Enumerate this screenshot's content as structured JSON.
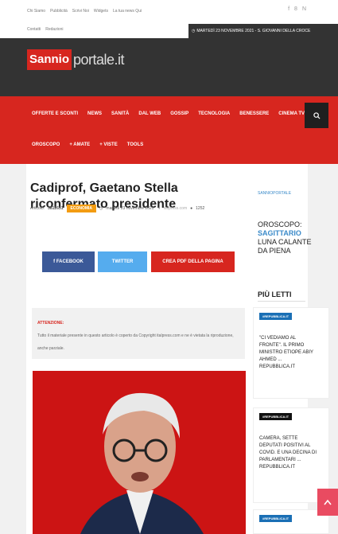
{
  "topbar": {
    "links": [
      "Chi Siamo",
      "Pubblicità",
      "Scrivi Noi",
      "Widgets",
      "La tua news Qui"
    ],
    "links2": [
      "Contatti",
      "Redazioni"
    ],
    "date": "MARTEDÌ 23 NOVEMBRE 2021 - S. GIOVANNI DELLA CROCE",
    "social": [
      "f",
      "8",
      "N"
    ]
  },
  "logo": {
    "red": "Sannio",
    "gray": "portale.it"
  },
  "nav": {
    "row1": [
      "OFFERTE E SCONTI",
      "NEWS",
      "SANITÀ",
      "DAL WEB",
      "GOSSIP",
      "TECNOLOGIA",
      "BENESSERE",
      "CINEMA TV"
    ],
    "row2": [
      "OROSCOPO",
      "+ AMATE",
      "+ VISTE",
      "TOOLS"
    ]
  },
  "article": {
    "title": "Cadiprof, Gaetano Stella riconfermato presidente",
    "id_label": "Articolo:",
    "id": "3812631",
    "category": "ECONOMIA",
    "date": "martedì 23 novembre 2021",
    "author": "italpress.com",
    "views": "1252"
  },
  "share": {
    "facebook": "f FACEBOOK",
    "twitter": "TWITTER",
    "pdf": "CREA PDF DELLA PAGINA"
  },
  "notice": {
    "heading": "ATTENZIONE:",
    "line1": "Tutto il materiale presente in questo articolo è coperto da Copyright italpress.com e ne è vietata la riproduzione,",
    "line2": "anche parziale."
  },
  "sidebar": {
    "tag": "SANNIOPORTALE",
    "oroscopo_label": "OROSCOPO:",
    "sign": "SAGITTARIO",
    "moon": "LUNA CALANTE DA PIENA",
    "piu_letti": "PIÙ LETTI",
    "cards": [
      {
        "tag": "#REPUBBLICA.IT",
        "text": "\"CI VEDIAMO AL FRONTE\". IL PRIMO MINISTRO ETIOPE ABIY AHMED ... REPUBBLICA.IT"
      },
      {
        "tag": "#REPUBBLICA.IT",
        "text": "CAMERA, SETTE DEPUTATI POSITIVI AL COVID. E UNA DECINA DI PARLAMENTARI ... REPUBBLICA.IT"
      },
      {
        "tag": "#REPUBBLICA.IT",
        "text": ""
      }
    ]
  },
  "colors": {
    "brand_red": "#d7261f",
    "dark": "#333333",
    "accent_blue": "#3a8ac9",
    "badge_orange": "#f39c12",
    "scroll_pink": "#e94b61"
  }
}
